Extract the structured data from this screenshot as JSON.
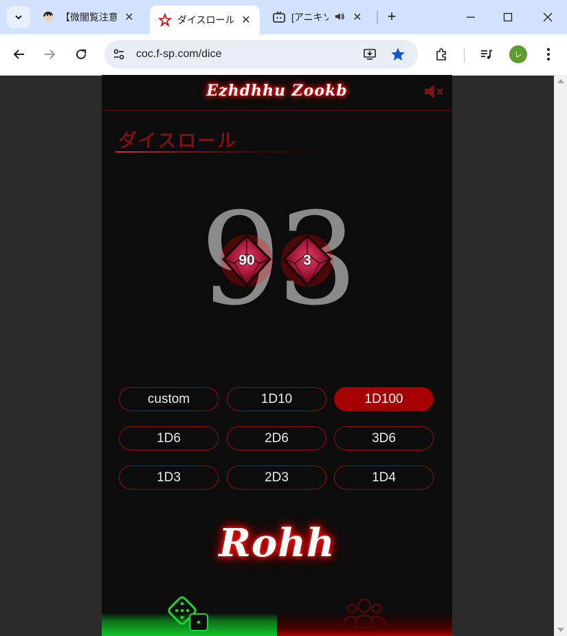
{
  "browser": {
    "tabs": [
      {
        "title": "【微闇覧注意】",
        "active": false,
        "audio": false
      },
      {
        "title": "ダイスロール - ",
        "active": true,
        "audio": false
      },
      {
        "title": "[アニキソ",
        "active": false,
        "audio": true
      }
    ],
    "url": "coc.f-sp.com/dice",
    "profile_initial": "レ"
  },
  "page": {
    "logo_text": "Ezhdhhu Zookb",
    "title": "ダイスロール",
    "result": "93",
    "dice": [
      {
        "value": "90",
        "type": "d10 (tens)"
      },
      {
        "value": "3",
        "type": "d10 (ones)"
      }
    ],
    "buttons": [
      {
        "label": "custom",
        "selected": false
      },
      {
        "label": "1D10",
        "selected": false
      },
      {
        "label": "1D100",
        "selected": true
      },
      {
        "label": "1D6",
        "selected": false
      },
      {
        "label": "2D6",
        "selected": false
      },
      {
        "label": "3D6",
        "selected": false
      },
      {
        "label": "1D3",
        "selected": false
      },
      {
        "label": "2D3",
        "selected": false
      },
      {
        "label": "1D4",
        "selected": false
      }
    ],
    "roll_label": "Rohh",
    "nav": [
      {
        "icon": "dice-icon",
        "active": true,
        "color": "#10c52a"
      },
      {
        "icon": "group-icon",
        "active": false,
        "color": "#b30000"
      }
    ],
    "colors": {
      "accent": "#a50000",
      "background": "#0c0c0c",
      "active_nav": "#10c52a"
    }
  }
}
